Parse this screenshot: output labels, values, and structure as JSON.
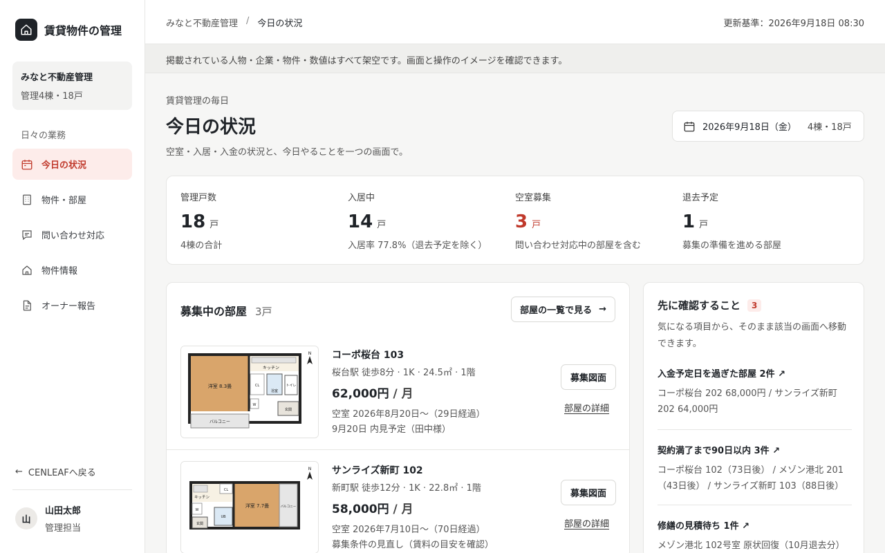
{
  "sidebar": {
    "app_title": "賃貸物件の管理",
    "org": {
      "name": "みなと不動産管理",
      "summary": "管理4棟・18戸"
    },
    "nav_heading": "日々の業務",
    "items": [
      {
        "label": "今日の状況",
        "icon": "calendar-icon",
        "active": true
      },
      {
        "label": "物件・部屋",
        "icon": "building-icon",
        "active": false
      },
      {
        "label": "問い合わせ対応",
        "icon": "chat-icon",
        "active": false
      },
      {
        "label": "物件情報",
        "icon": "house-icon",
        "active": false
      },
      {
        "label": "オーナー報告",
        "icon": "document-icon",
        "active": false
      }
    ],
    "back_label": "CENLEAFへ戻る",
    "user": {
      "initial": "山",
      "name": "山田太郎",
      "role": "管理担当"
    }
  },
  "header": {
    "breadcrumb": [
      "みなと不動産管理",
      "今日の状況"
    ],
    "breadcrumb_sep": "/",
    "updated": "更新基準：2026年9月18日 08:30"
  },
  "notice": "掲載されている人物・企業・物件・数値はすべて架空です。画面と操作のイメージを確認できます。",
  "page": {
    "eyebrow": "賃貸管理の毎日",
    "title": "今日の状況",
    "description": "空室・入居・入金の状況と、今日やることを一つの画面で。",
    "date": "2026年9月18日（金）",
    "date_units": "4棟・18戸"
  },
  "stats": [
    {
      "label": "管理戸数",
      "value": "18",
      "unit": "戸",
      "note": "4棟の合計",
      "highlight": false
    },
    {
      "label": "入居中",
      "value": "14",
      "unit": "戸",
      "note": "入居率 77.8%（退去予定を除く）",
      "highlight": false
    },
    {
      "label": "空室募集",
      "value": "3",
      "unit": "戸",
      "note": "問い合わせ対応中の部屋を含む",
      "highlight": true
    },
    {
      "label": "退去予定",
      "value": "1",
      "unit": "戸",
      "note": "募集の準備を進める部屋",
      "highlight": false
    }
  ],
  "vacancies": {
    "title": "募集中の部屋",
    "count": "3戸",
    "list_button": "部屋の一覧で見る",
    "plan_button": "募集図面",
    "detail_link": "部屋の詳細",
    "rooms": [
      {
        "name": "コーポ桜台 103",
        "meta": "桜台駅 徒歩8分 · 1K · 24.5㎡ · 1階",
        "rent": "62,000円",
        "per": " / 月",
        "status": "空室 2026年8月20日〜（29日経過）",
        "schedule": "9月20日 内見予定（田中様）",
        "plan_labels": {
          "room": "洋室 8.3畳",
          "kitchen": "キッチン",
          "balcony": "バルコニー",
          "cl": "CL",
          "bath": "浴室",
          "toilet": "トイレ",
          "w": "W",
          "entrance": "玄関",
          "north": "N"
        }
      },
      {
        "name": "サンライズ新町 102",
        "meta": "新町駅 徒歩12分 · 1K · 22.8㎡ · 1階",
        "rent": "58,000円",
        "per": " / 月",
        "status": "空室 2026年7月10日〜（70日経過）",
        "schedule": "募集条件の見直し（賃料の目安を確認）",
        "plan_labels": {
          "room": "洋室 7.7畳",
          "kitchen": "キッチン",
          "balcony": "バルコニー",
          "cl": "CL",
          "bath": "UB",
          "w": "W",
          "entrance": "玄関",
          "north": "N"
        }
      }
    ]
  },
  "todo": {
    "title": "先に確認すること",
    "badge": "3",
    "description": "気になる項目から、そのまま該当の画面へ移動できます。",
    "items": [
      {
        "title": "入金予定日を過ぎた部屋 2件 ↗",
        "body": "コーポ桜台 202 68,000円 / サンライズ新町 202 64,000円"
      },
      {
        "title": "契約満了まで90日以内 3件 ↗",
        "body": "コーポ桜台 102（73日後） / メゾン港北 201（43日後） / サンライズ新町 103（88日後）"
      },
      {
        "title": "修繕の見積待ち 1件 ↗",
        "body": "メゾン港北 102号室 原状回復（10月退去分）"
      }
    ]
  },
  "colors": {
    "accent": "#c0392b",
    "accent_bg": "#fdecea",
    "brand": "#1f2328"
  }
}
